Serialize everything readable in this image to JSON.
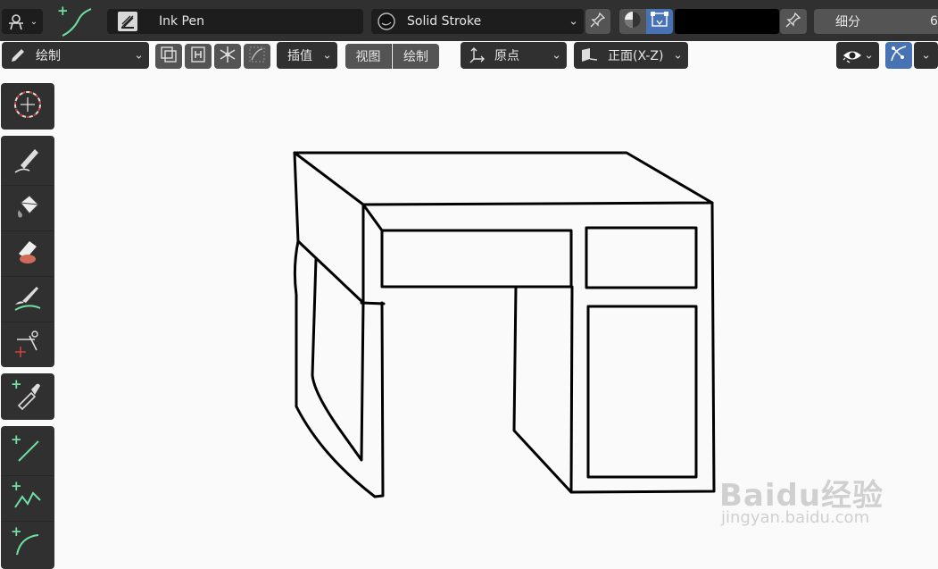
{
  "header": {
    "brush_name": "Ink Pen",
    "material_name": "Solid Stroke",
    "subdivision_label": "细分",
    "subdivision_value": "6"
  },
  "toolbar": {
    "mode_label": "绘制",
    "interpolate_label": "插值",
    "view_label": "视图",
    "draw_label": "绘制",
    "origin_label": "原点",
    "plane_label": "正面(X-Z)"
  },
  "tools": [
    {
      "name": "cursor"
    },
    {
      "name": "draw"
    },
    {
      "name": "fill"
    },
    {
      "name": "erase"
    },
    {
      "name": "tint"
    },
    {
      "name": "cutter"
    },
    {
      "name": "eyedropper"
    },
    {
      "name": "line"
    },
    {
      "name": "polyline"
    },
    {
      "name": "arc"
    }
  ],
  "watermark": {
    "logo": "Baidu经验",
    "url": "jingyan.baidu.com"
  },
  "colors": {
    "panel": "#303030",
    "field": "#282828",
    "accent": "#4772b3",
    "stroke": "#000000",
    "add_icon": "#6fe0a0"
  }
}
